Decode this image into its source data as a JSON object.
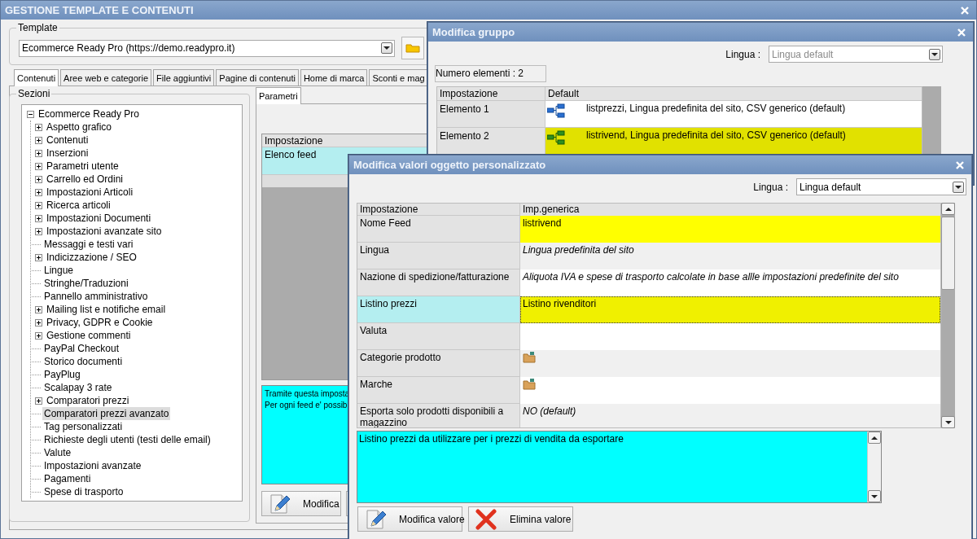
{
  "main_window": {
    "title": "GESTIONE TEMPLATE E CONTENUTI",
    "template": {
      "label": "Template",
      "value": "Ecommerce Ready Pro (https://demo.readypro.it)"
    },
    "tabs": [
      {
        "label": "Contenuti",
        "selected": true
      },
      {
        "label": "Aree web e categorie",
        "selected": false
      },
      {
        "label": "File aggiuntivi",
        "selected": false
      },
      {
        "label": "Pagine di contenuti",
        "selected": false
      },
      {
        "label": "Home di marca",
        "selected": false
      },
      {
        "label": "Sconti e mag",
        "selected": false
      }
    ],
    "sections": {
      "label": "Sezioni",
      "tree": [
        {
          "label": "Ecommerce Ready Pro",
          "expanded": true,
          "selected": false,
          "children": [
            {
              "label": "Aspetto grafico",
              "expandable": true,
              "selected": false
            },
            {
              "label": "Contenuti",
              "expandable": true,
              "selected": false
            },
            {
              "label": "Inserzioni",
              "expandable": true,
              "selected": false
            },
            {
              "label": "Parametri utente",
              "expandable": true,
              "selected": false
            },
            {
              "label": "Carrello ed Ordini",
              "expandable": true,
              "selected": false
            },
            {
              "label": "Impostazioni Articoli",
              "expandable": true,
              "selected": false
            },
            {
              "label": "Ricerca articoli",
              "expandable": true,
              "selected": false
            },
            {
              "label": "Impostazioni Documenti",
              "expandable": true,
              "selected": false
            },
            {
              "label": "Impostazioni avanzate sito",
              "expandable": true,
              "selected": false
            },
            {
              "label": "Messaggi e testi vari",
              "expandable": false,
              "selected": false
            },
            {
              "label": "Indicizzazione / SEO",
              "expandable": true,
              "selected": false
            },
            {
              "label": "Lingue",
              "expandable": false,
              "selected": false
            },
            {
              "label": "Stringhe/Traduzioni",
              "expandable": false,
              "selected": false
            },
            {
              "label": "Pannello amministrativo",
              "expandable": false,
              "selected": false
            },
            {
              "label": "Mailing list e notifiche email",
              "expandable": true,
              "selected": false
            },
            {
              "label": "Privacy, GDPR e Cookie",
              "expandable": true,
              "selected": false
            },
            {
              "label": "Gestione commenti",
              "expandable": true,
              "selected": false
            },
            {
              "label": "PayPal Checkout",
              "expandable": false,
              "selected": false
            },
            {
              "label": "Storico documenti",
              "expandable": false,
              "selected": false
            },
            {
              "label": "PayPlug",
              "expandable": false,
              "selected": false
            },
            {
              "label": "Scalapay 3 rate",
              "expandable": false,
              "selected": false
            },
            {
              "label": "Comparatori prezzi",
              "expandable": true,
              "selected": false
            },
            {
              "label": "Comparatori prezzi avanzato",
              "expandable": false,
              "selected": true
            },
            {
              "label": "Tag personalizzati",
              "expandable": false,
              "selected": false
            },
            {
              "label": "Richieste degli utenti (testi delle email)",
              "expandable": false,
              "selected": false
            },
            {
              "label": "Valute",
              "expandable": false,
              "selected": false
            },
            {
              "label": "Impostazioni avanzate",
              "expandable": false,
              "selected": false
            },
            {
              "label": "Pagamenti",
              "expandable": false,
              "selected": false
            },
            {
              "label": "Spese di trasporto",
              "expandable": false,
              "selected": false
            }
          ]
        }
      ]
    },
    "panel": {
      "tabs": [
        {
          "label": "Parametri",
          "selected": true
        }
      ],
      "table": {
        "columns": [
          "Impostazione"
        ],
        "rows": [
          {
            "setting": "Elenco feed",
            "selected": true
          }
        ]
      },
      "description_lines": [
        "Tramite questa imposta",
        "Per ogni feed e' possib"
      ],
      "buttons": [
        {
          "label": "Modifica"
        }
      ]
    }
  },
  "group_dialog": {
    "title": "Modifica gruppo",
    "language": {
      "label": "Lingua :",
      "value": "Lingua default",
      "disabled": true
    },
    "count": "Numero elementi : 2",
    "table": {
      "columns": [
        "Impostazione",
        "Default"
      ],
      "rows": [
        {
          "setting": "Elemento 1",
          "value": "listprezzi, Lingua predefinita del sito, CSV generico (default)",
          "selected": false
        },
        {
          "setting": "Elemento 2",
          "value": "listrivend, Lingua predefinita del sito, CSV generico (default)",
          "selected": true
        }
      ]
    }
  },
  "values_dialog": {
    "title": "Modifica valori oggetto personalizzato",
    "language": {
      "label": "Lingua :",
      "value": "Lingua default",
      "disabled": false
    },
    "table": {
      "columns": [
        "Impostazione",
        "Imp.generica"
      ],
      "rows": [
        {
          "setting": "Nome Feed",
          "kind": "text",
          "value": "listrivend",
          "inherited": false,
          "edited": true,
          "selected": false
        },
        {
          "setting": "Lingua",
          "kind": "text",
          "value": "Lingua predefinita del sito",
          "inherited": true,
          "edited": false,
          "selected": false
        },
        {
          "setting": "Nazione di spedizione/fatturazione",
          "kind": "text",
          "value": "Aliquota IVA e spese di trasporto calcolate in base allle impostazioni predefinite del sito",
          "inherited": true,
          "edited": false,
          "selected": false
        },
        {
          "setting": "Listino prezzi",
          "kind": "text",
          "value": "Listino rivenditori",
          "inherited": false,
          "edited": true,
          "selected": true
        },
        {
          "setting": "Valuta",
          "kind": "empty",
          "edited": false,
          "selected": false
        },
        {
          "setting": "Categorie prodotto",
          "kind": "folder",
          "edited": false,
          "selected": false
        },
        {
          "setting": "Marche",
          "kind": "folder",
          "edited": false,
          "selected": false
        },
        {
          "setting": "Esporta solo prodotti disponibili a magazzino",
          "kind": "text",
          "value": "NO (default)",
          "inherited": true,
          "edited": false,
          "selected": false
        }
      ]
    },
    "description": "Listino prezzi da utilizzare per i prezzi di vendita da esportare",
    "buttons": [
      {
        "label": "Modifica valore",
        "kind": "edit"
      },
      {
        "label": "Elimina valore",
        "kind": "delete"
      }
    ]
  }
}
